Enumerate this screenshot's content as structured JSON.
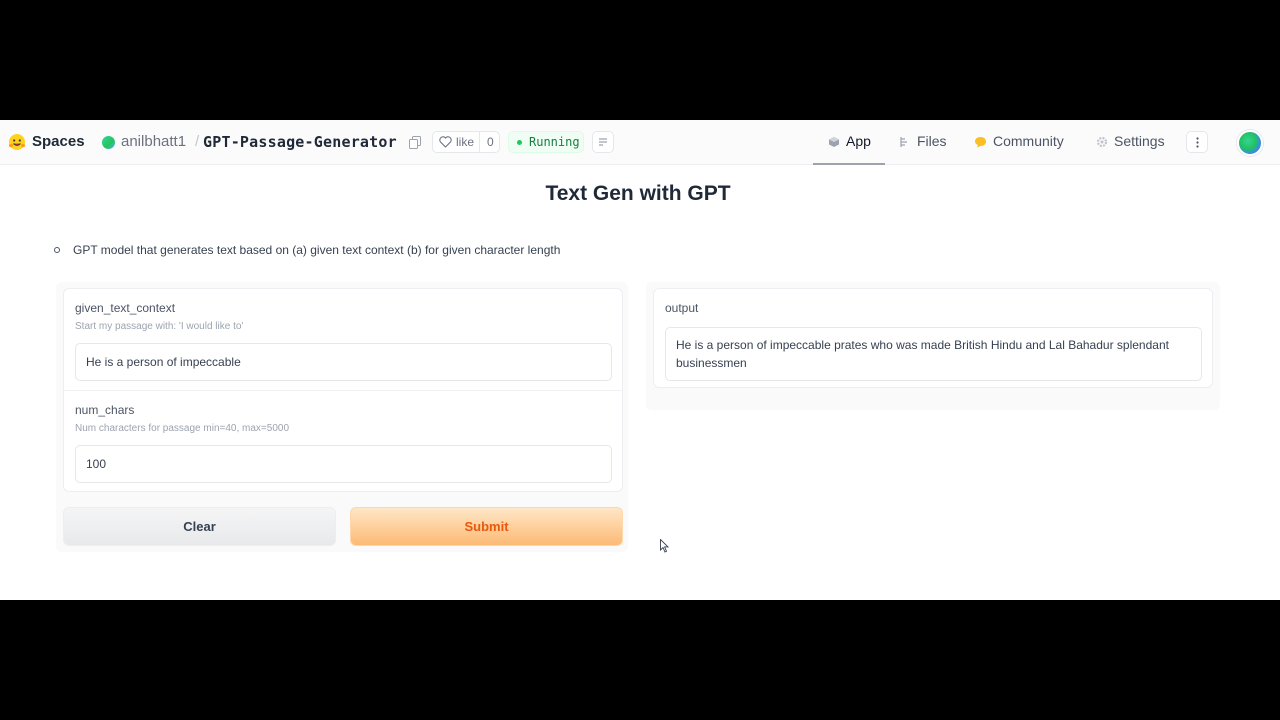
{
  "header": {
    "spaces_label": "Spaces",
    "owner": "anilbhatt1",
    "separator": "/",
    "repo": "GPT-Passage-Generator",
    "like_label": "like",
    "like_count": "0",
    "status": "Running",
    "nav": [
      {
        "label": "App",
        "icon": "cube-icon"
      },
      {
        "label": "Files",
        "icon": "files-icon"
      },
      {
        "label": "Community",
        "icon": "community-icon"
      },
      {
        "label": "Settings",
        "icon": "gear-icon"
      }
    ]
  },
  "main": {
    "title": "Text Gen with GPT",
    "description": "GPT model that generates text based on (a) given text context (b) for given character length",
    "inputs": [
      {
        "label": "given_text_context",
        "info": "Start my passage with: 'I would like to'",
        "value": "He is a person of impeccable"
      },
      {
        "label": "num_chars",
        "info": "Num characters for passage min=40, max=5000",
        "value": "100"
      }
    ],
    "clear_label": "Clear",
    "submit_label": "Submit",
    "output_label": "output",
    "output_value": "He is a person of impeccable prates who was made British Hindu and Lal Bahadur splendant businessmen"
  },
  "colors": {
    "accent": "#ea580c",
    "running": "#22c55e"
  }
}
